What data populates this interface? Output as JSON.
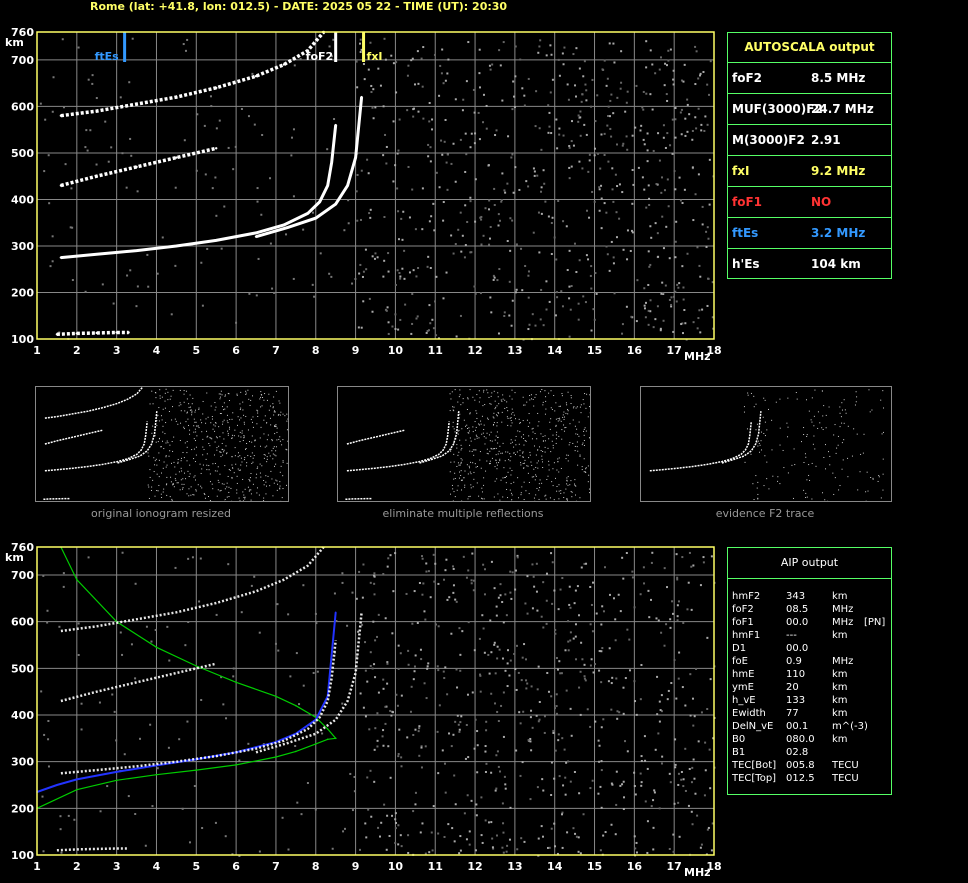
{
  "header": "Rome (lat: +41.8, lon: 012.5) - DATE: 2025 05 22 - TIME (UT): 20:30",
  "colors": {
    "grid": "#888888",
    "frame": "#ffff66",
    "box_border": "#55ff66",
    "foF2": "#ffffff",
    "fxI": "#ffff66",
    "foF1": "#ff3333",
    "ftEs": "#3399ff",
    "profile": "#00cc00",
    "fit": "#2233ff"
  },
  "chart_data": [
    {
      "type": "scatter",
      "title": "",
      "xlabel": "MHz",
      "ylabel": "km",
      "xlim": [
        1,
        18
      ],
      "ylim": [
        100,
        760
      ],
      "x_ticks": [
        1,
        2,
        3,
        4,
        5,
        6,
        7,
        8,
        9,
        10,
        11,
        12,
        13,
        14,
        15,
        16,
        17,
        18
      ],
      "y_ticks": [
        100,
        200,
        300,
        400,
        500,
        600,
        700,
        760
      ],
      "grid": true,
      "markers": [
        {
          "label": "ftEs",
          "x": 3.2,
          "color": "#3399ff"
        },
        {
          "label": "foF2",
          "x": 8.5,
          "color": "#ffffff"
        },
        {
          "label": "fxI",
          "x": 9.2,
          "color": "#ffff66"
        }
      ],
      "traces": [
        {
          "name": "F2 o-trace",
          "x": [
            1.6,
            2.5,
            3.5,
            4.5,
            5.5,
            6.5,
            7.2,
            7.8,
            8.1,
            8.3,
            8.4,
            8.5
          ],
          "y": [
            275,
            282,
            290,
            300,
            312,
            328,
            345,
            370,
            395,
            430,
            480,
            560
          ]
        },
        {
          "name": "F2 x-trace",
          "x": [
            6.5,
            7.3,
            8.0,
            8.5,
            8.8,
            9.0,
            9.15
          ],
          "y": [
            320,
            340,
            360,
            390,
            430,
            490,
            620
          ]
        },
        {
          "name": "2F2 echo",
          "x": [
            1.6,
            2.5,
            3.5,
            4.5,
            5.5,
            6.5,
            7.2,
            7.8,
            8.2
          ],
          "y": [
            580,
            590,
            605,
            620,
            640,
            665,
            690,
            720,
            760
          ]
        },
        {
          "name": "3F2 echo",
          "x": [
            1.6,
            2.5,
            3.5,
            4.5,
            5.5
          ],
          "y": [
            430,
            450,
            470,
            490,
            510
          ]
        },
        {
          "name": "Es trace",
          "x": [
            1.5,
            2.0,
            2.5,
            3.0,
            3.3
          ],
          "y": [
            110,
            112,
            113,
            114,
            114
          ]
        }
      ]
    },
    {
      "type": "line",
      "title": "",
      "xlabel": "MHz",
      "ylabel": "km",
      "xlim": [
        1,
        18
      ],
      "ylim": [
        100,
        760
      ],
      "x_ticks": [
        1,
        2,
        3,
        4,
        5,
        6,
        7,
        8,
        9,
        10,
        11,
        12,
        13,
        14,
        15,
        16,
        17,
        18
      ],
      "y_ticks": [
        100,
        200,
        300,
        400,
        500,
        600,
        700,
        760
      ],
      "grid": true,
      "series": [
        {
          "name": "",
          "x": [
            1.0,
            2.0,
            3.0,
            4.0,
            5.0,
            6.0,
            7.0,
            7.5,
            8.0,
            8.3,
            8.5,
            8.3,
            8.0,
            7.5,
            7.0,
            6.0,
            5.0,
            4.0,
            3.0,
            2.0,
            1.6
          ],
          "y": [
            200,
            240,
            260,
            272,
            282,
            293,
            310,
            322,
            338,
            348,
            350,
            370,
            395,
            420,
            440,
            470,
            505,
            545,
            600,
            690,
            760
          ]
        },
        {
          "name": "",
          "x": [
            1.0,
            1.5,
            2.0,
            3.0,
            4.0,
            5.0,
            6.0,
            7.0,
            7.5,
            8.0,
            8.3,
            8.5
          ],
          "y": [
            235,
            250,
            262,
            278,
            292,
            305,
            320,
            342,
            360,
            390,
            440,
            620
          ]
        }
      ]
    }
  ],
  "autoscala": {
    "title": "AUTOSCALA output",
    "rows": [
      {
        "label": "foF2",
        "value": "8.5 MHz",
        "color": "#ffffff"
      },
      {
        "label": "MUF(3000)F2",
        "value": "24.7 MHz",
        "color": "#ffffff"
      },
      {
        "label": "M(3000)F2",
        "value": "2.91",
        "color": "#ffffff"
      },
      {
        "label": "fxI",
        "value": "9.2 MHz",
        "color": "#ffff66"
      },
      {
        "label": "foF1",
        "value": "NO",
        "color": "#ff3333"
      },
      {
        "label": "ftEs",
        "value": "3.2 MHz",
        "color": "#3399ff"
      },
      {
        "label": "h'Es",
        "value": "104    km",
        "color": "#ffffff"
      }
    ]
  },
  "aip": {
    "title": "AIP output",
    "rows": [
      {
        "name": "hmF2",
        "value": "343",
        "unit": "km",
        "extra": ""
      },
      {
        "name": "foF2",
        "value": "08.5",
        "unit": "MHz",
        "extra": ""
      },
      {
        "name": "foF1",
        "value": "00.0",
        "unit": "MHz",
        "extra": "[PN]"
      },
      {
        "name": "hmF1",
        "value": "---",
        "unit": "km",
        "extra": ""
      },
      {
        "name": "D1",
        "value": "00.0",
        "unit": "",
        "extra": ""
      },
      {
        "name": "foE",
        "value": "0.9",
        "unit": "MHz",
        "extra": ""
      },
      {
        "name": "hmE",
        "value": "110",
        "unit": "km",
        "extra": ""
      },
      {
        "name": "ymE",
        "value": "20",
        "unit": "km",
        "extra": ""
      },
      {
        "name": "h_vE",
        "value": "133",
        "unit": "km",
        "extra": ""
      },
      {
        "name": "Ewidth",
        "value": "77",
        "unit": "km",
        "extra": ""
      },
      {
        "name": "DelN_vE",
        "value": "00.1",
        "unit": "m^(-3)",
        "extra": ""
      },
      {
        "name": "B0",
        "value": "080.0",
        "unit": "km",
        "extra": ""
      },
      {
        "name": "B1",
        "value": "02.8",
        "unit": "",
        "extra": ""
      },
      {
        "name": "TEC[Bot]",
        "value": "005.8",
        "unit": "TECU",
        "extra": ""
      },
      {
        "name": "TEC[Top]",
        "value": "012.5",
        "unit": "TECU",
        "extra": ""
      }
    ]
  },
  "thumbnails": [
    {
      "caption": "original ionogram resized"
    },
    {
      "caption": "eliminate multiple reflections"
    },
    {
      "caption": "evidence F2 trace"
    }
  ]
}
